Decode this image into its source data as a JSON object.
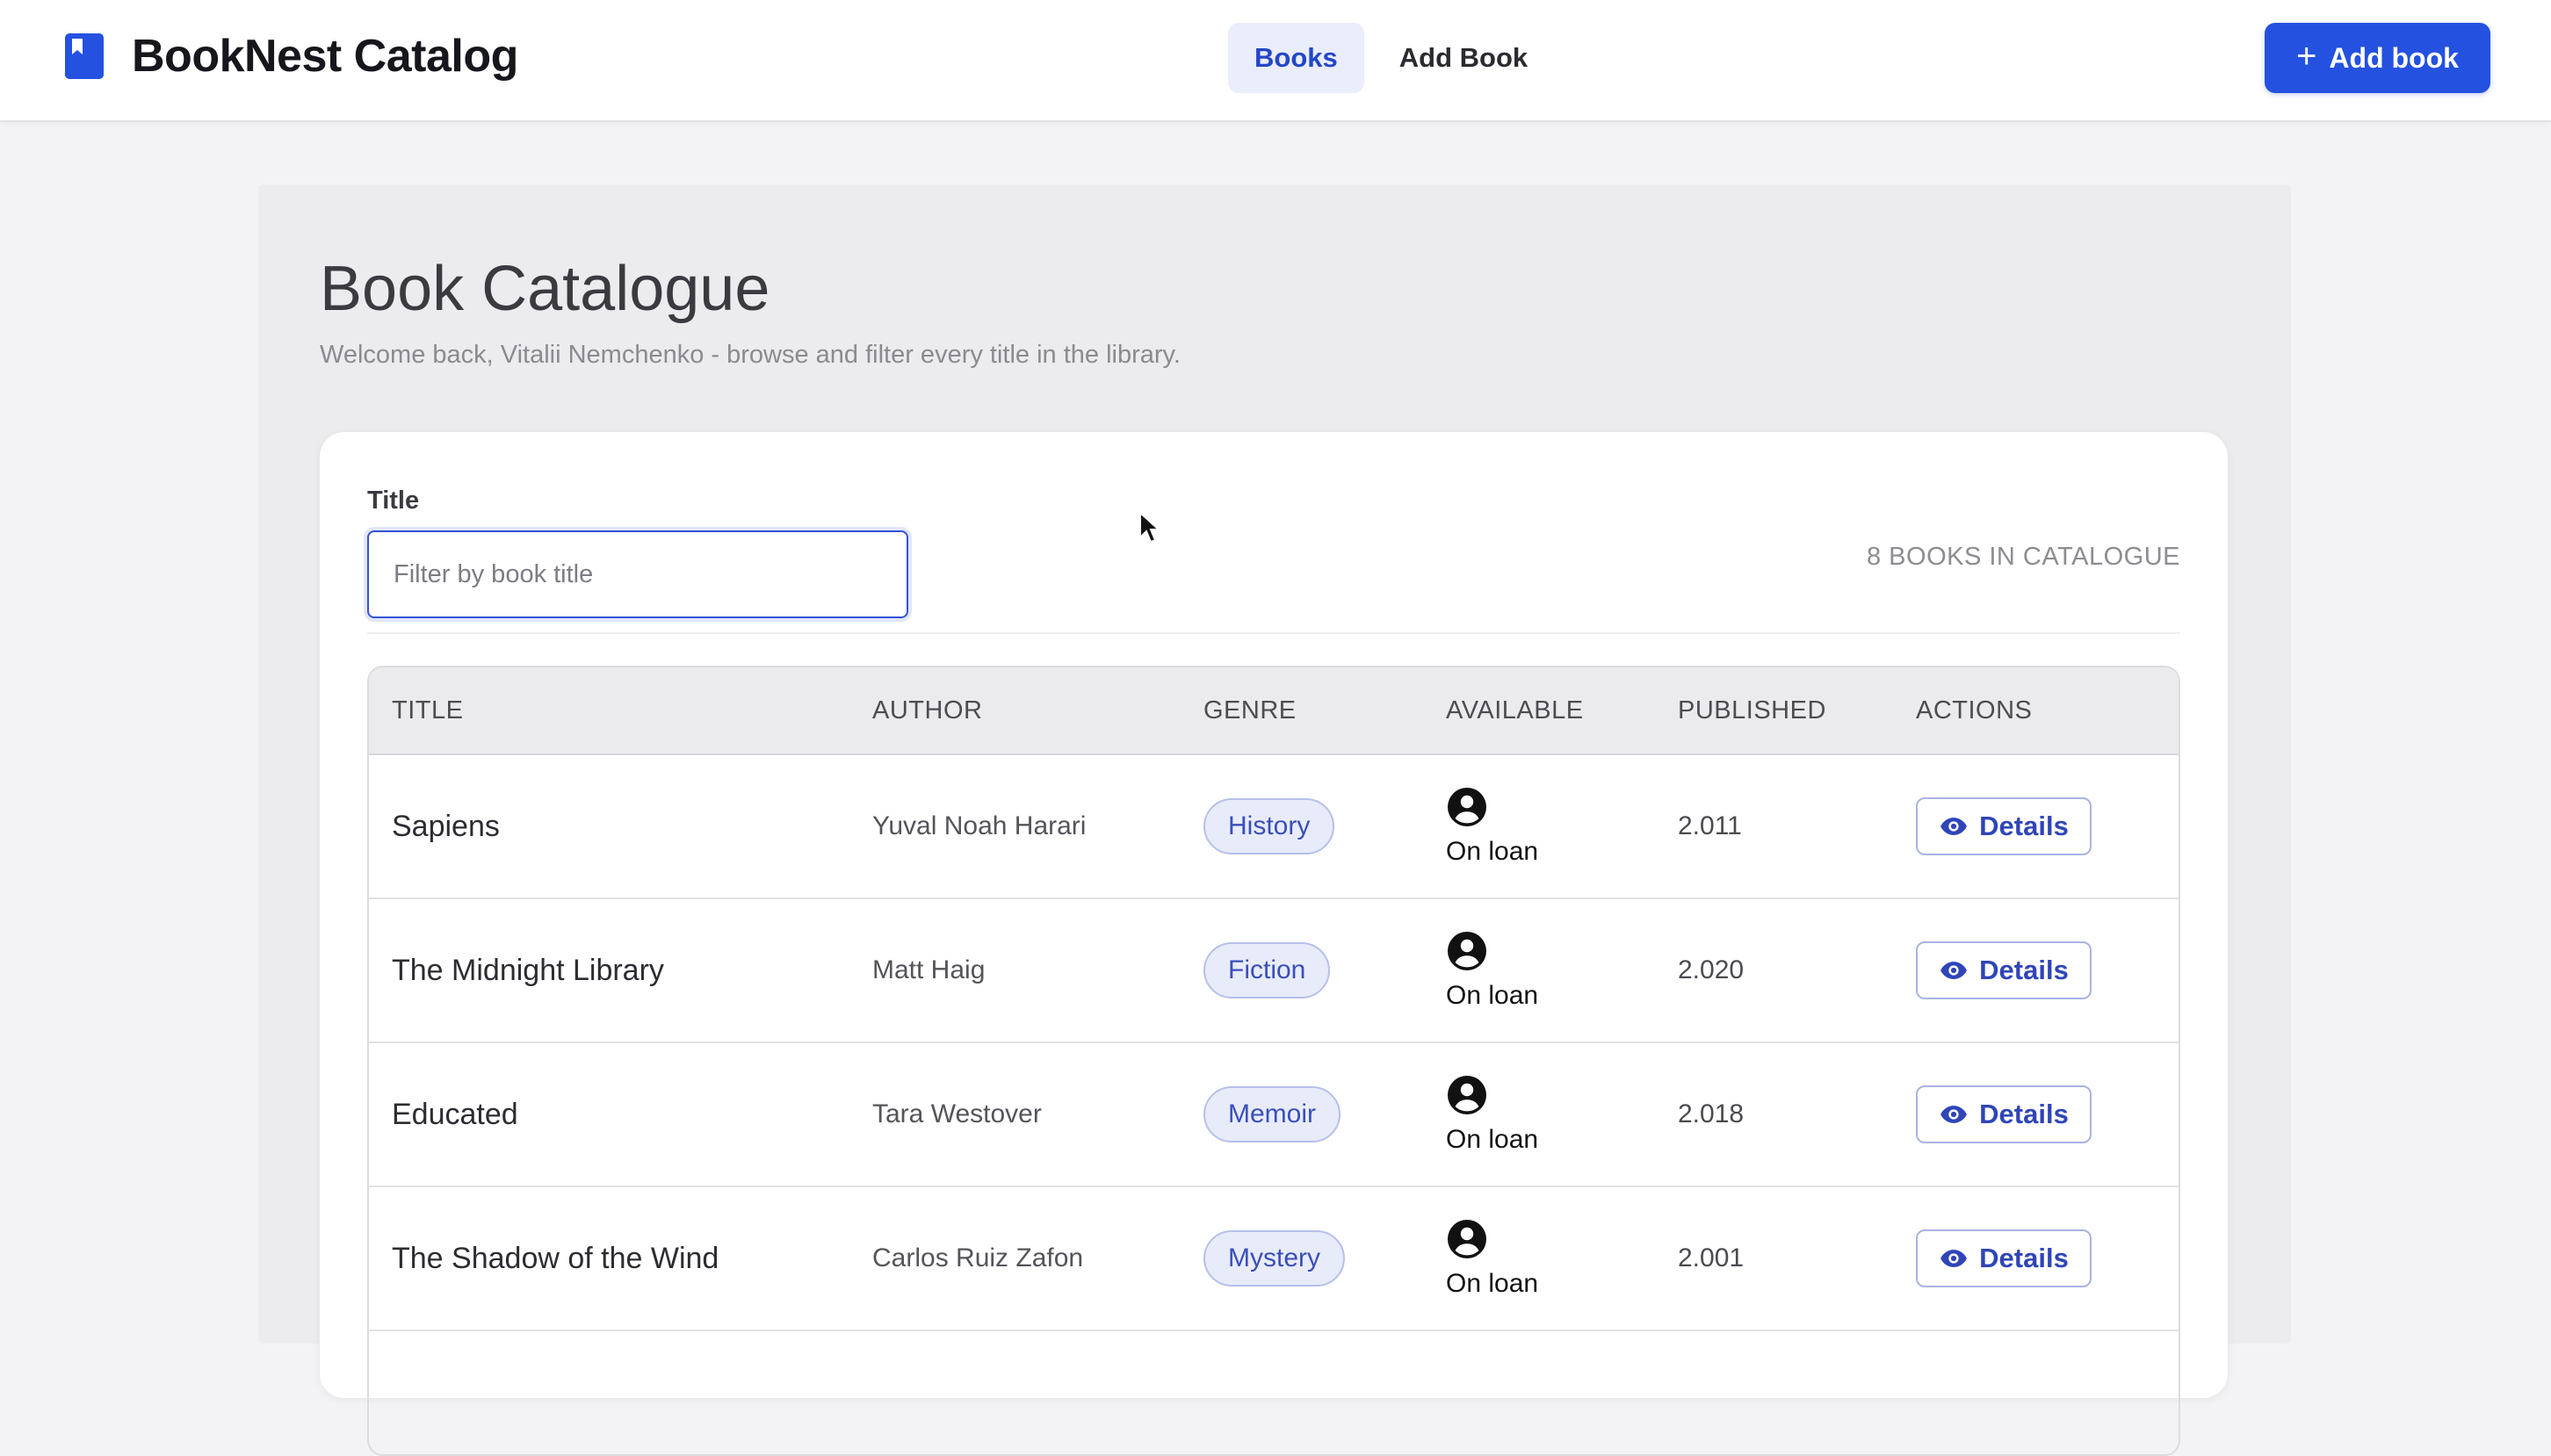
{
  "header": {
    "brand": "BookNest Catalog",
    "brand_icon": "bookmark-icon",
    "nav": [
      {
        "label": "Books",
        "active": true
      },
      {
        "label": "Add Book",
        "active": false
      }
    ],
    "primary_button": "Add book",
    "accent_color": "#2451e0"
  },
  "page": {
    "title": "Book Catalogue",
    "subtitle": "Welcome back, Vitalii Nemchenko - browse and filter every title in the library."
  },
  "filter": {
    "label": "Title",
    "placeholder": "Filter by book title",
    "value": "",
    "count_text": "8 BOOKS IN CATALOGUE"
  },
  "table": {
    "headers": [
      "TITLE",
      "AUTHOR",
      "GENRE",
      "AVAILABLE",
      "PUBLISHED",
      "ACTIONS"
    ],
    "rows": [
      {
        "title": "Sapiens",
        "author": "Yuval Noah Harari",
        "genre": "History",
        "available": "On loan",
        "published": "2.011",
        "action": "Details"
      },
      {
        "title": "The Midnight Library",
        "author": "Matt Haig",
        "genre": "Fiction",
        "available": "On loan",
        "published": "2.020",
        "action": "Details"
      },
      {
        "title": "Educated",
        "author": "Tara Westover",
        "genre": "Memoir",
        "available": "On loan",
        "published": "2.018",
        "action": "Details"
      },
      {
        "title": "The Shadow of the Wind",
        "author": "Carlos Ruiz Zafon",
        "genre": "Mystery",
        "available": "On loan",
        "published": "2.001",
        "action": "Details"
      }
    ]
  }
}
